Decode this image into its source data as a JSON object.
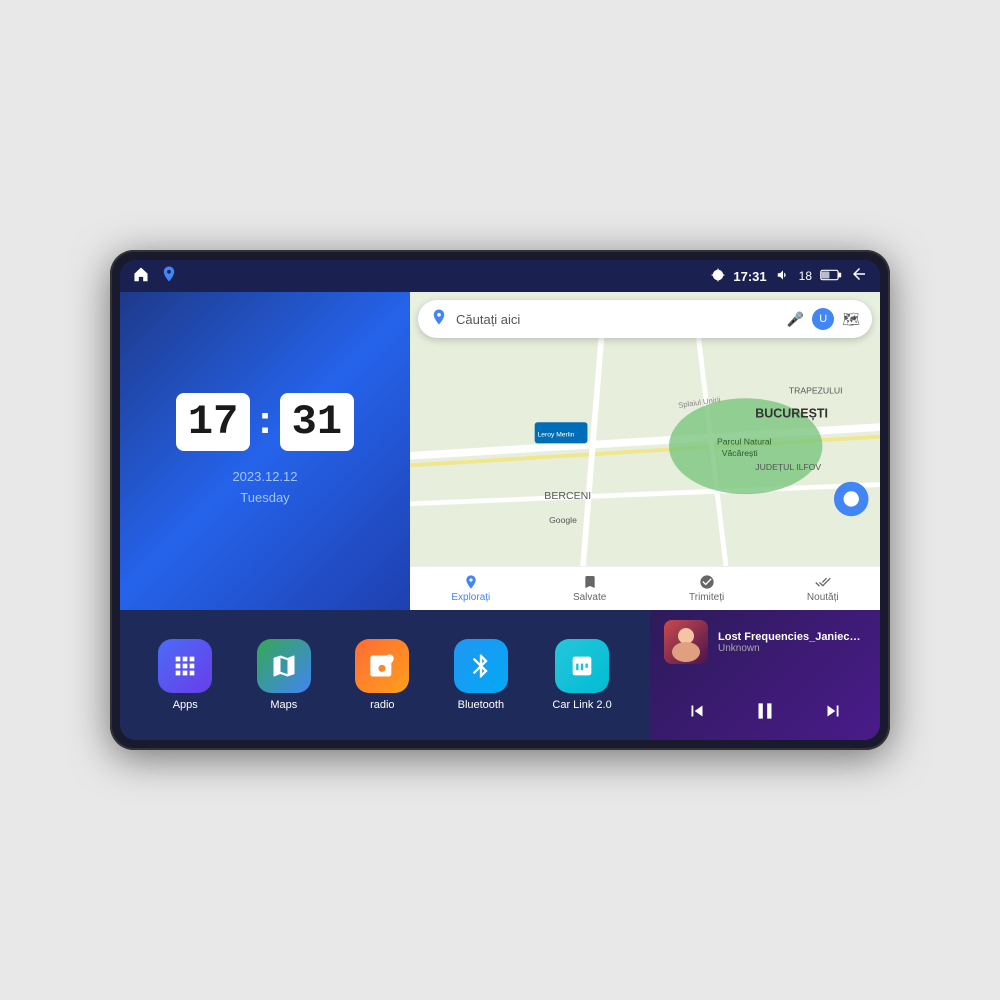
{
  "device": {
    "status_bar": {
      "nav_icon_home": "⌂",
      "nav_icon_maps": "📍",
      "time": "17:31",
      "volume_icon": "🔊",
      "battery_level": "18",
      "battery_icon": "🔋",
      "back_icon": "↩"
    },
    "clock": {
      "hours": "17",
      "minutes": "31",
      "date": "2023.12.12",
      "day": "Tuesday"
    },
    "map": {
      "search_placeholder": "Căutați aici",
      "bottom_tabs": [
        "Explorați",
        "Salvate",
        "Trimiteți",
        "Noutăți"
      ]
    },
    "apps": [
      {
        "id": "apps",
        "label": "Apps",
        "icon_class": "icon-apps"
      },
      {
        "id": "maps",
        "label": "Maps",
        "icon_class": "icon-maps"
      },
      {
        "id": "radio",
        "label": "radio",
        "icon_class": "icon-radio"
      },
      {
        "id": "bluetooth",
        "label": "Bluetooth",
        "icon_class": "icon-bluetooth"
      },
      {
        "id": "carlink",
        "label": "Car Link 2.0",
        "icon_class": "icon-carlink"
      }
    ],
    "music": {
      "title": "Lost Frequencies_Janieck Devy-...",
      "artist": "Unknown",
      "prev_label": "⏮",
      "play_label": "⏸",
      "next_label": "⏭"
    }
  }
}
